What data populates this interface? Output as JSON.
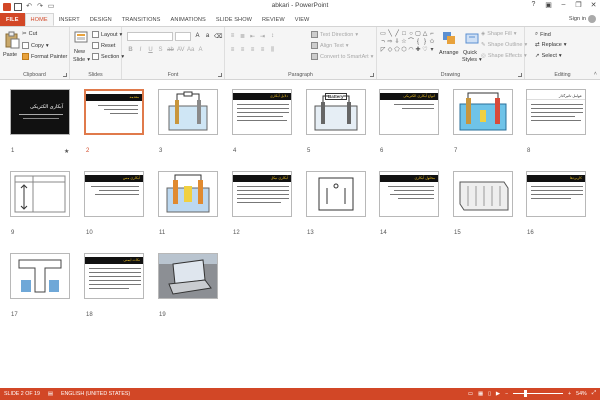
{
  "window": {
    "title": "abkari - PowerPoint"
  },
  "tabs": [
    {
      "label": "FILE"
    },
    {
      "label": "HOME"
    },
    {
      "label": "INSERT"
    },
    {
      "label": "DESIGN"
    },
    {
      "label": "TRANSITIONS"
    },
    {
      "label": "ANIMATIONS"
    },
    {
      "label": "SLIDE SHOW"
    },
    {
      "label": "REVIEW"
    },
    {
      "label": "VIEW"
    }
  ],
  "account": {
    "signin": "Sign in"
  },
  "ribbon": {
    "clipboard": {
      "label": "Clipboard",
      "paste": "Paste",
      "cut": "Cut",
      "copy": "Copy",
      "format_painter": "Format Painter"
    },
    "slides": {
      "label": "Slides",
      "new_slide_line1": "New",
      "new_slide_line2": "Slide",
      "layout": "Layout",
      "reset": "Reset",
      "section": "Section"
    },
    "font": {
      "label": "Font"
    },
    "paragraph": {
      "label": "Paragraph",
      "text_direction": "Text Direction",
      "align_text": "Align Text",
      "smartart": "Convert to SmartArt"
    },
    "drawing": {
      "label": "Drawing",
      "arrange": "Arrange",
      "quick_styles_line1": "Quick",
      "quick_styles_line2": "Styles",
      "shape_fill": "Shape Fill",
      "shape_outline": "Shape Outline",
      "shape_effects": "Shape Effects"
    },
    "editing": {
      "label": "Editing",
      "find": "Find",
      "replace": "Replace",
      "select": "Select"
    }
  },
  "slides": [
    {
      "num": "1",
      "title": "آبکاری الکتریکی"
    },
    {
      "num": "2",
      "title": "مقدمه"
    },
    {
      "num": "3",
      "title": ""
    },
    {
      "num": "4",
      "title": "دلایل آبکاری"
    },
    {
      "num": "5",
      "title": "Battery"
    },
    {
      "num": "6",
      "title": "انواع آبکاری الکتریکی"
    },
    {
      "num": "7",
      "title": ""
    },
    {
      "num": "8",
      "title": "عوامل تاثیرگذار"
    },
    {
      "num": "9",
      "title": ""
    },
    {
      "num": "10",
      "title": "آبکاری مس"
    },
    {
      "num": "11",
      "title": ""
    },
    {
      "num": "12",
      "title": "آبکاری نیکل"
    },
    {
      "num": "13",
      "title": ""
    },
    {
      "num": "14",
      "title": "محلول آبکاری"
    },
    {
      "num": "15",
      "title": ""
    },
    {
      "num": "16",
      "title": "کاربردها"
    },
    {
      "num": "17",
      "title": ""
    },
    {
      "num": "18",
      "title": "نکات ایمنی"
    },
    {
      "num": "19",
      "title": ""
    }
  ],
  "status": {
    "slide_counter": "SLIDE 2 OF 19",
    "language": "ENGLISH (UNITED STATES)",
    "zoom": "54%",
    "zoom_percent": 54
  },
  "colors": {
    "accent": "#d24726",
    "selection": "#e07a4b"
  }
}
